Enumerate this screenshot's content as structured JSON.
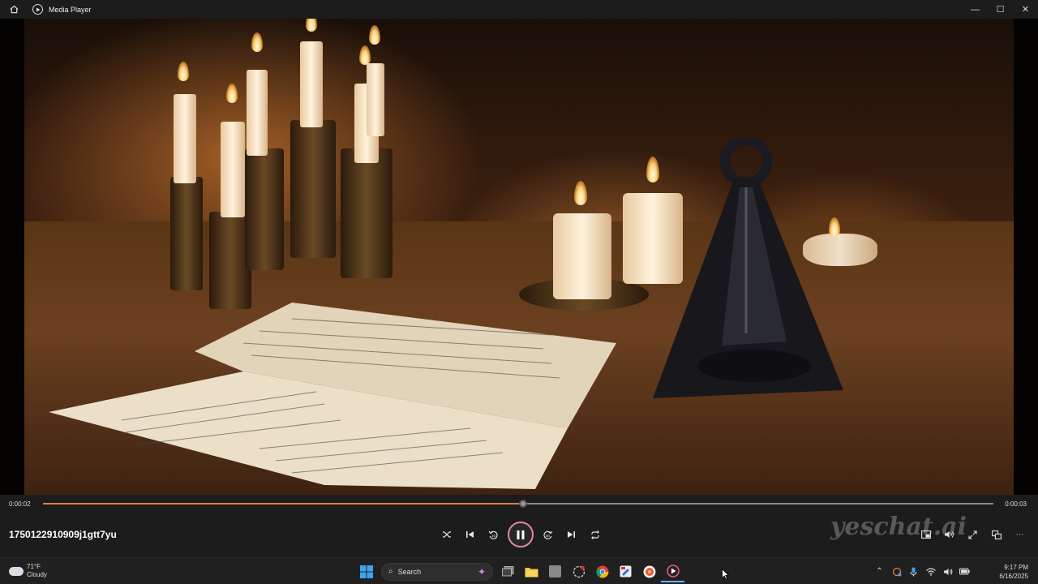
{
  "window": {
    "title": "Media Player",
    "controls": [
      "minimize",
      "maximize",
      "close"
    ]
  },
  "player": {
    "current_time": "0:00:02",
    "total_time": "0:00:03",
    "progress": 0.505,
    "file_name": "1750122910909j1gtt7yu",
    "state": "playing",
    "accent_color": "#e8793a",
    "watermark": "yeschat.ai"
  },
  "controls": {
    "center": [
      {
        "name": "shuffle-button",
        "icon": "shuffle-icon",
        "glyph": "⤭"
      },
      {
        "name": "previous-button",
        "icon": "skip-previous-icon",
        "glyph": "⏮"
      },
      {
        "name": "rewind-10-button",
        "icon": "rewind-10-icon",
        "glyph": "↺"
      },
      {
        "name": "forward-30-button",
        "icon": "forward-30-icon",
        "glyph": "↻"
      },
      {
        "name": "next-button",
        "icon": "skip-next-icon",
        "glyph": "⏭"
      },
      {
        "name": "repeat-button",
        "icon": "repeat-icon",
        "glyph": "⟲"
      }
    ],
    "right": [
      {
        "name": "miniplayer-button",
        "icon": "miniplayer-icon",
        "glyph": "▭"
      },
      {
        "name": "volume-button",
        "icon": "volume-icon",
        "glyph": "🔊"
      },
      {
        "name": "fullscreen-button",
        "icon": "fullscreen-icon",
        "glyph": "⤢"
      },
      {
        "name": "cast-button",
        "icon": "cast-icon",
        "glyph": "⧉"
      },
      {
        "name": "more-options-button",
        "icon": "more-icon",
        "glyph": "⋯"
      }
    ]
  },
  "taskbar": {
    "weather": {
      "temp": "71°F",
      "condition": "Cloudy"
    },
    "search_label": "Search",
    "apps": [
      "windows-start",
      "search",
      "task-view",
      "file-explorer",
      "app-gray",
      "app-snipping",
      "chrome",
      "app-pen",
      "app-red-circle",
      "media-player"
    ],
    "clock": {
      "time": "9:17 PM",
      "date": "6/16/2025"
    }
  }
}
